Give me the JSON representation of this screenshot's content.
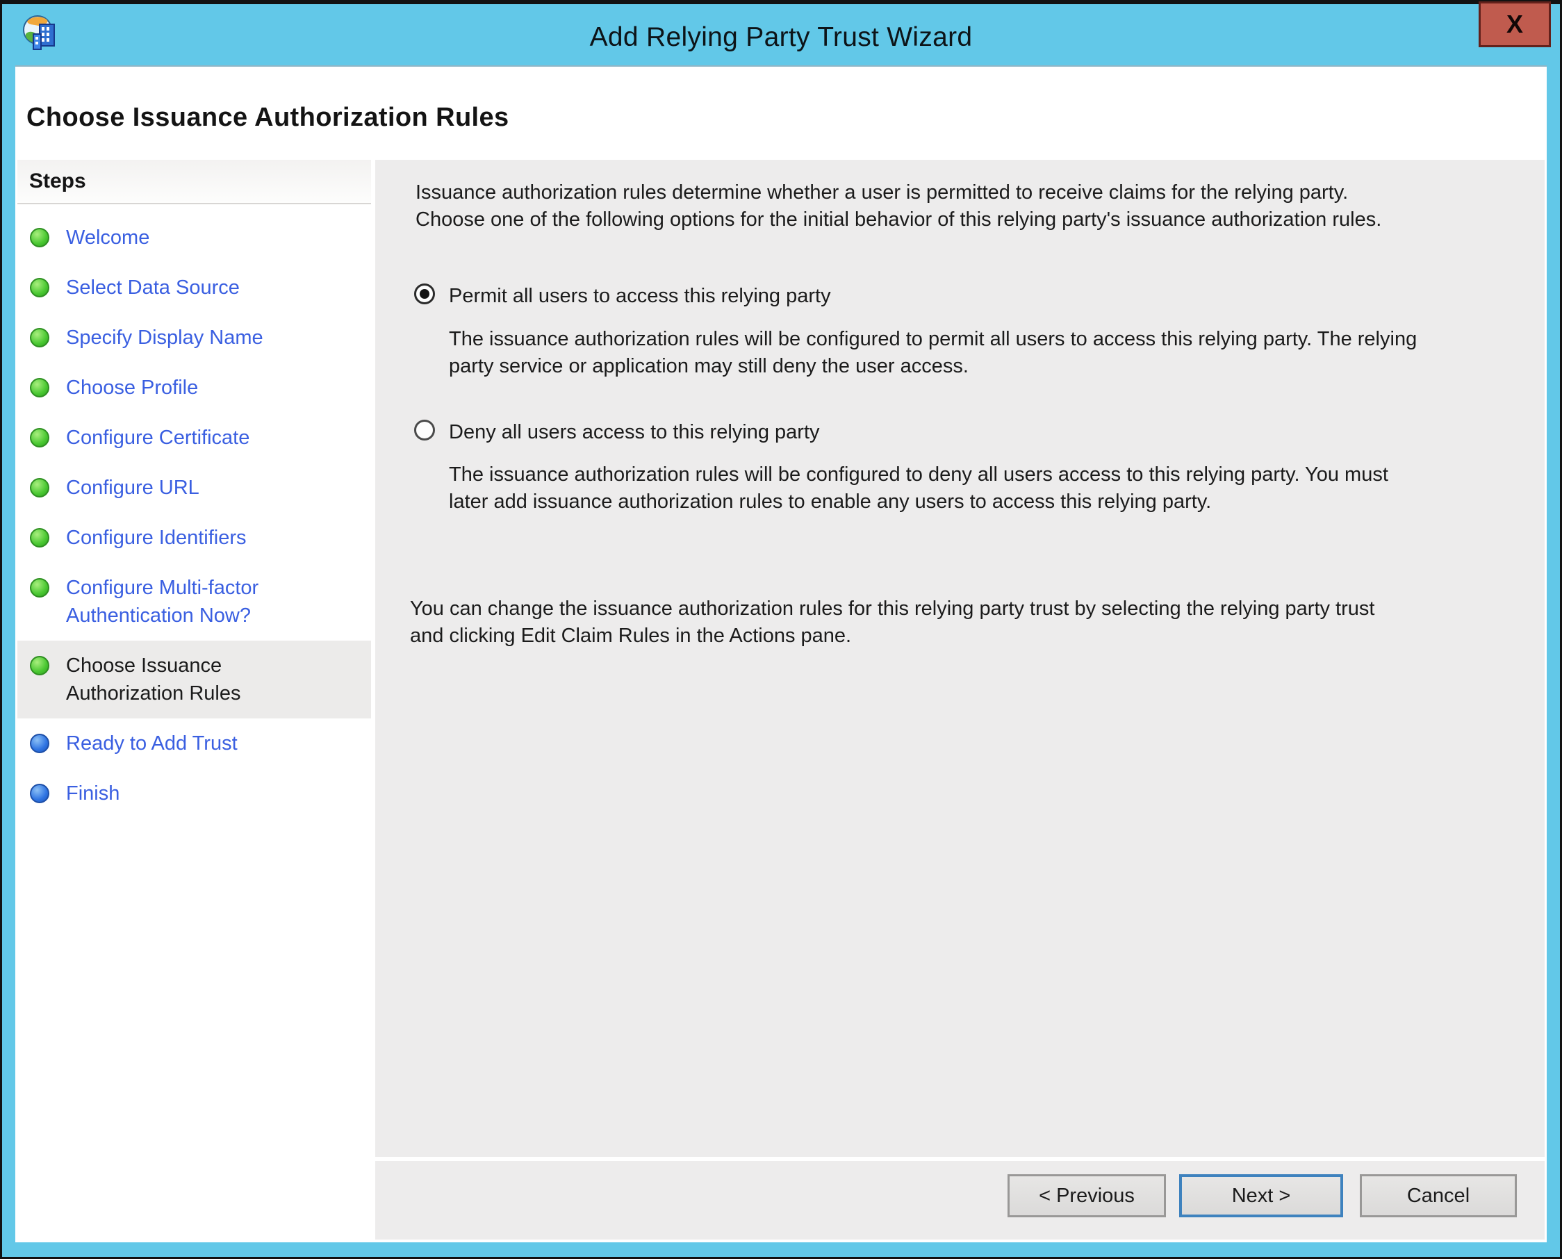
{
  "window": {
    "title": "Add Relying Party Trust Wizard",
    "icon": "adfs-wizard-icon",
    "close_label": "X"
  },
  "page": {
    "heading": "Choose Issuance Authorization Rules"
  },
  "steps": {
    "header": "Steps",
    "items": [
      {
        "label": "Welcome",
        "status": "completed",
        "current": false
      },
      {
        "label": "Select Data Source",
        "status": "completed",
        "current": false
      },
      {
        "label": "Specify Display Name",
        "status": "completed",
        "current": false
      },
      {
        "label": "Choose Profile",
        "status": "completed",
        "current": false
      },
      {
        "label": "Configure Certificate",
        "status": "completed",
        "current": false
      },
      {
        "label": "Configure URL",
        "status": "completed",
        "current": false
      },
      {
        "label": "Configure Identifiers",
        "status": "completed",
        "current": false
      },
      {
        "label": "Configure Multi-factor\nAuthentication Now?",
        "status": "completed",
        "current": false
      },
      {
        "label": "Choose Issuance\nAuthorization Rules",
        "status": "completed",
        "current": true
      },
      {
        "label": "Ready to Add Trust",
        "status": "upcoming",
        "current": false
      },
      {
        "label": "Finish",
        "status": "upcoming",
        "current": false
      }
    ]
  },
  "content": {
    "intro": "Issuance authorization rules determine whether a user is permitted to receive claims for the relying party.\nChoose one of the following options for the initial behavior of this relying party's issuance authorization rules.",
    "options": [
      {
        "label": "Permit all users to access this relying party",
        "selected": true,
        "description": "The issuance authorization rules will be configured to permit all users to access this relying party. The relying\nparty service or application may still deny the user access."
      },
      {
        "label": "Deny all users access to this relying party",
        "selected": false,
        "description": "The issuance authorization rules will be configured to deny all users access to this relying party. You must\nlater add issuance authorization rules to enable any users to access this relying party."
      }
    ],
    "note": "You can change the issuance authorization rules for this relying party trust by selecting the relying party trust\nand clicking Edit Claim Rules in the Actions pane."
  },
  "footer": {
    "previous_label": "< Previous",
    "next_label": "Next >",
    "cancel_label": "Cancel"
  },
  "colors": {
    "titlebar_blue": "#62c8e8",
    "close_red": "#c05b4e",
    "link_blue": "#3a5fe1",
    "step_completed_green": "#44bf2e",
    "step_upcoming_blue": "#2c72e0",
    "panel_gray": "#edecec",
    "default_button_border_blue": "#3e82be",
    "text_black": "#1b1b1b"
  }
}
